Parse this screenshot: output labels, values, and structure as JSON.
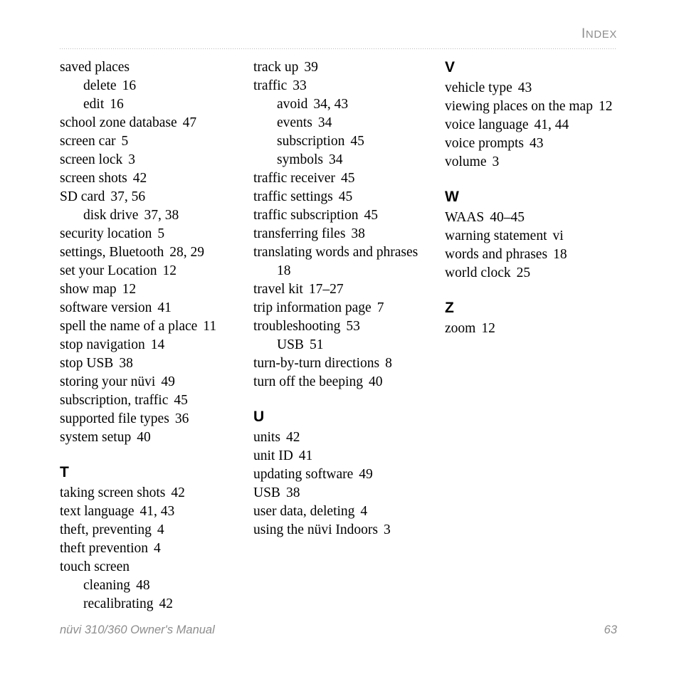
{
  "header": {
    "running_head_cap": "I",
    "running_head_rest": "NDEX"
  },
  "footer": {
    "manual_title": "nüvi 310/360 Owner's Manual",
    "page_number": "63"
  },
  "columns": [
    {
      "id": "column-1",
      "blocks": [
        {
          "type": "entry",
          "level": 1,
          "text": "saved places",
          "pages": ""
        },
        {
          "type": "entry",
          "level": 2,
          "text": "delete",
          "pages": "16"
        },
        {
          "type": "entry",
          "level": 2,
          "text": "edit",
          "pages": "16"
        },
        {
          "type": "entry",
          "level": 1,
          "text": "school zone database",
          "pages": "47"
        },
        {
          "type": "entry",
          "level": 1,
          "text": "screen car",
          "pages": "5"
        },
        {
          "type": "entry",
          "level": 1,
          "text": "screen lock",
          "pages": "3"
        },
        {
          "type": "entry",
          "level": 1,
          "text": "screen shots",
          "pages": "42"
        },
        {
          "type": "entry",
          "level": 1,
          "text": "SD card",
          "pages": "37, 56"
        },
        {
          "type": "entry",
          "level": 2,
          "text": "disk drive",
          "pages": "37, 38"
        },
        {
          "type": "entry",
          "level": 1,
          "text": "security location",
          "pages": "5"
        },
        {
          "type": "entry",
          "level": 1,
          "text": "settings, Bluetooth",
          "pages": "28, 29"
        },
        {
          "type": "entry",
          "level": 1,
          "text": "set your Location",
          "pages": "12"
        },
        {
          "type": "entry",
          "level": 1,
          "text": "show map",
          "pages": "12"
        },
        {
          "type": "entry",
          "level": 1,
          "text": "software version",
          "pages": "41"
        },
        {
          "type": "entry",
          "level": 1,
          "text": "spell the name of a place",
          "pages": "11"
        },
        {
          "type": "entry",
          "level": 1,
          "text": "stop navigation",
          "pages": "14"
        },
        {
          "type": "entry",
          "level": 1,
          "text": "stop USB",
          "pages": "38"
        },
        {
          "type": "entry",
          "level": 1,
          "text": "storing your nüvi",
          "pages": "49"
        },
        {
          "type": "entry",
          "level": 1,
          "text": "subscription, traffic",
          "pages": "45"
        },
        {
          "type": "entry",
          "level": 1,
          "text": "supported file types",
          "pages": "36"
        },
        {
          "type": "entry",
          "level": 1,
          "text": "system setup",
          "pages": "40"
        },
        {
          "type": "letter",
          "text": "T"
        },
        {
          "type": "entry",
          "level": 1,
          "text": "taking screen shots",
          "pages": "42"
        },
        {
          "type": "entry",
          "level": 1,
          "text": "text language",
          "pages": "41, 43"
        },
        {
          "type": "entry",
          "level": 1,
          "text": "theft, preventing",
          "pages": "4"
        },
        {
          "type": "entry",
          "level": 1,
          "text": "theft prevention",
          "pages": "4"
        },
        {
          "type": "entry",
          "level": 1,
          "text": "touch screen",
          "pages": ""
        },
        {
          "type": "entry",
          "level": 2,
          "text": "cleaning",
          "pages": "48"
        },
        {
          "type": "entry",
          "level": 2,
          "text": "recalibrating",
          "pages": "42"
        }
      ]
    },
    {
      "id": "column-2",
      "blocks": [
        {
          "type": "entry",
          "level": 1,
          "text": "track up",
          "pages": "39"
        },
        {
          "type": "entry",
          "level": 1,
          "text": "traffic",
          "pages": "33"
        },
        {
          "type": "entry",
          "level": 2,
          "text": "avoid",
          "pages": "34, 43"
        },
        {
          "type": "entry",
          "level": 2,
          "text": "events",
          "pages": "34"
        },
        {
          "type": "entry",
          "level": 2,
          "text": "subscription",
          "pages": "45"
        },
        {
          "type": "entry",
          "level": 2,
          "text": "symbols",
          "pages": "34"
        },
        {
          "type": "entry",
          "level": 1,
          "text": "traffic receiver",
          "pages": "45"
        },
        {
          "type": "entry",
          "level": 1,
          "text": "traffic settings",
          "pages": "45"
        },
        {
          "type": "entry",
          "level": 1,
          "text": "traffic subscription",
          "pages": "45"
        },
        {
          "type": "entry",
          "level": 1,
          "text": "transferring files",
          "pages": "38"
        },
        {
          "type": "entry-wrapped",
          "level": 1,
          "text": "translating words and phrases",
          "pages": "18"
        },
        {
          "type": "entry",
          "level": 1,
          "text": "travel kit",
          "pages": "17–27"
        },
        {
          "type": "entry",
          "level": 1,
          "text": "trip information page",
          "pages": "7"
        },
        {
          "type": "entry",
          "level": 1,
          "text": "troubleshooting",
          "pages": "53"
        },
        {
          "type": "entry",
          "level": 2,
          "text": "USB",
          "pages": "51"
        },
        {
          "type": "entry",
          "level": 1,
          "text": "turn-by-turn directions",
          "pages": "8"
        },
        {
          "type": "entry",
          "level": 1,
          "text": "turn off the beeping",
          "pages": "40"
        },
        {
          "type": "letter",
          "text": "U"
        },
        {
          "type": "entry",
          "level": 1,
          "text": "units",
          "pages": "42"
        },
        {
          "type": "entry",
          "level": 1,
          "text": "unit ID",
          "pages": "41"
        },
        {
          "type": "entry",
          "level": 1,
          "text": "updating software",
          "pages": "49"
        },
        {
          "type": "entry",
          "level": 1,
          "text": "USB",
          "pages": "38"
        },
        {
          "type": "entry",
          "level": 1,
          "text": "user data, deleting",
          "pages": "4"
        },
        {
          "type": "entry",
          "level": 1,
          "text": "using the nüvi Indoors",
          "pages": "3"
        }
      ]
    },
    {
      "id": "column-3",
      "blocks": [
        {
          "type": "letter",
          "text": "V",
          "first": true
        },
        {
          "type": "entry",
          "level": 1,
          "text": "vehicle type",
          "pages": "43"
        },
        {
          "type": "entry",
          "level": 1,
          "text": "viewing places on the map",
          "pages": "12"
        },
        {
          "type": "entry",
          "level": 1,
          "text": "voice language",
          "pages": "41, 44"
        },
        {
          "type": "entry",
          "level": 1,
          "text": "voice prompts",
          "pages": "43"
        },
        {
          "type": "entry",
          "level": 1,
          "text": "volume",
          "pages": "3"
        },
        {
          "type": "letter",
          "text": "W"
        },
        {
          "type": "entry",
          "level": 1,
          "text": "WAAS",
          "pages": "40–45"
        },
        {
          "type": "entry",
          "level": 1,
          "text": "warning statement",
          "pages": "vi"
        },
        {
          "type": "entry",
          "level": 1,
          "text": "words and phrases",
          "pages": "18"
        },
        {
          "type": "entry",
          "level": 1,
          "text": "world clock",
          "pages": "25"
        },
        {
          "type": "letter",
          "text": "Z"
        },
        {
          "type": "entry",
          "level": 1,
          "text": "zoom",
          "pages": "12"
        }
      ]
    }
  ]
}
